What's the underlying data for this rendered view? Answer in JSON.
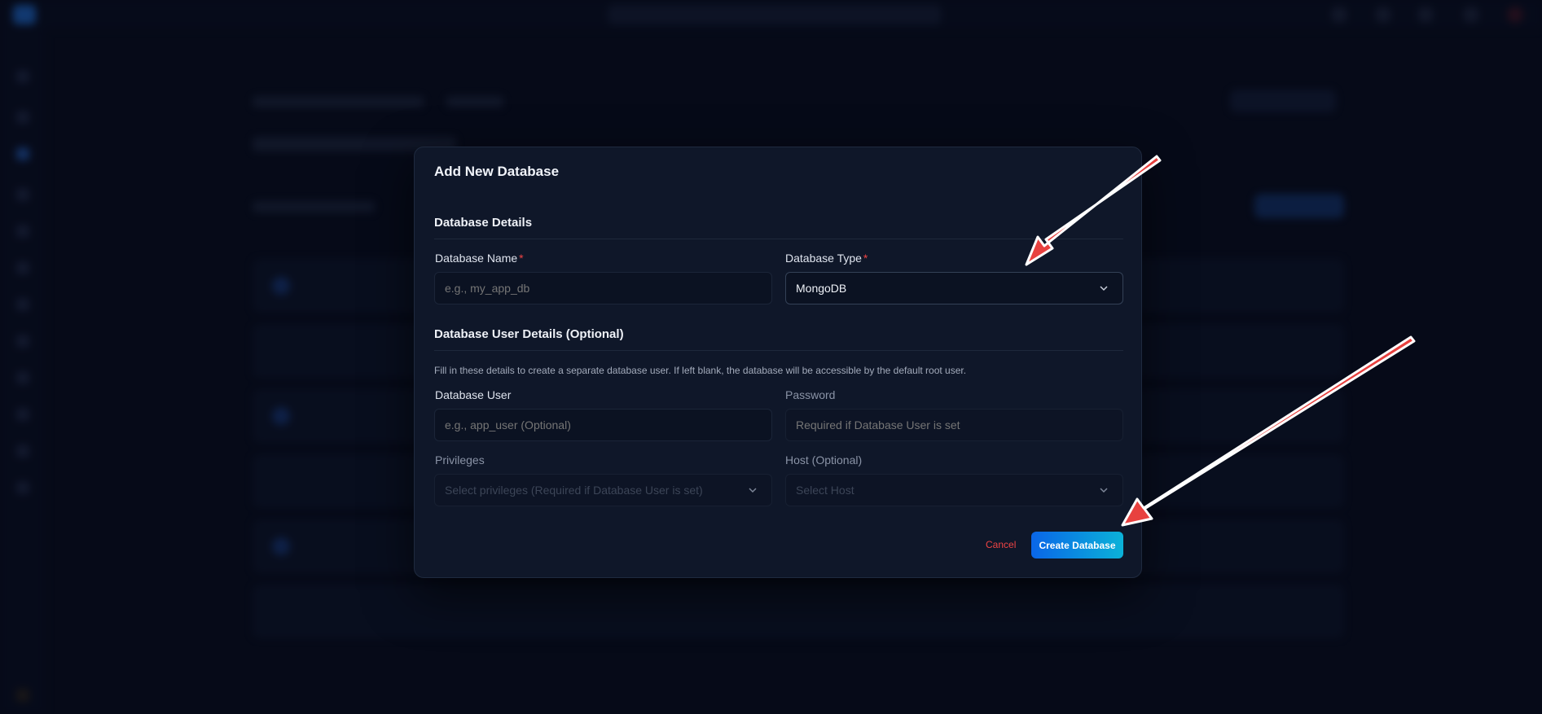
{
  "modal": {
    "title": "Add New Database",
    "section_details": "Database Details",
    "section_user": "Database User Details (Optional)",
    "help_text": "Fill in these details to create a separate database user. If left blank, the database will be accessible by the default root user.",
    "fields": {
      "db_name": {
        "label": "Database Name",
        "required_mark": "*",
        "placeholder": "e.g., my_app_db",
        "value": ""
      },
      "db_type": {
        "label": "Database Type",
        "required_mark": "*",
        "value": "MongoDB"
      },
      "db_user": {
        "label": "Database User",
        "placeholder": "e.g., app_user (Optional)",
        "value": ""
      },
      "password": {
        "label": "Password",
        "placeholder": "Required if Database User is set",
        "value": ""
      },
      "privileges": {
        "label": "Privileges",
        "placeholder": "Select privileges (Required if Database User is set)"
      },
      "host": {
        "label": "Host (Optional)",
        "placeholder": "Select Host"
      }
    },
    "buttons": {
      "cancel": "Cancel",
      "create": "Create Database"
    }
  },
  "colors": {
    "accent_gradient_start": "#0a66e8",
    "accent_gradient_end": "#0bb2d8",
    "required": "#ef4444",
    "annotation_arrow": "#e8413f",
    "modal_bg": "#0f1729",
    "page_bg": "#060a18"
  },
  "icons": {
    "select_chevron": "chevron-down-icon",
    "annotation": "arrow-annotation"
  }
}
